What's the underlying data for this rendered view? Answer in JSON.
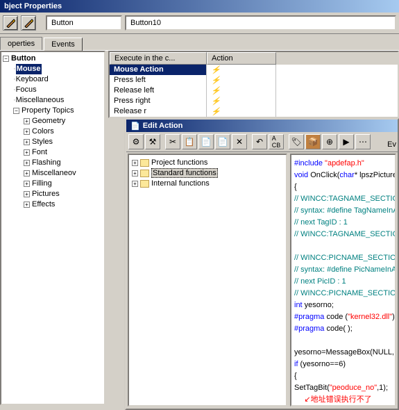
{
  "window": {
    "title": "bject Properties"
  },
  "toolbar": {
    "type_value": "Button",
    "name_value": "Button10"
  },
  "tabs": {
    "t0": "operties",
    "t1": "Events"
  },
  "tree": {
    "root": "Button",
    "n_mouse": "Mouse",
    "n_keyboard": "Keyboard",
    "n_focus": "Focus",
    "n_misc": "Miscellaneous",
    "n_property": "Property Topics",
    "p_geometry": "Geometry",
    "p_colors": "Colors",
    "p_styles": "Styles",
    "p_font": "Font",
    "p_flashing": "Flashing",
    "p_misc": "Miscellaneov",
    "p_filling": "Filling",
    "p_pictures": "Pictures",
    "p_effects": "Effects"
  },
  "grid": {
    "col_name": "Execute in the c...",
    "col_action": "Action",
    "r0": "Mouse Action",
    "r1": "Press left",
    "r2": "Release left",
    "r3": "Press right",
    "r4": "Release r"
  },
  "edit": {
    "title": "Edit Action",
    "btn_right": "Ev",
    "func": {
      "f0": "Project functions",
      "f1": "Standard functions",
      "f2": "Internal functions"
    },
    "code": {
      "l1_a": "#include ",
      "l1_b": "\"apdefap.h\"",
      "l2_a": "void",
      "l2_b": " OnClick(",
      "l2_c": "char",
      "l2_d": "* lpszPicture",
      "l3": "{",
      "l4": "// WINCC:TAGNAME_SECTIO",
      "l5": "// syntax: #define TagNameInA",
      "l6": "// next TagID : 1",
      "l7": "// WINCC:TAGNAME_SECTIO",
      "l8": "",
      "l9": "// WINCC:PICNAME_SECTIO",
      "l10": "// syntax: #define PicNameInA",
      "l11": "// next PicID : 1",
      "l12": "// WINCC:PICNAME_SECTIO",
      "l13_a": "int",
      "l13_b": " yesorno;",
      "l14_a": "#pragma",
      "l14_b": " code (",
      "l14_c": "\"kernel32.dll\"",
      "l14_d": ")",
      "l15_a": "#pragma",
      "l15_b": " code( );",
      "l16": "",
      "l17": "yesorno=MessageBox(NULL,",
      "l18_a": "if",
      "l18_b": " (yesorno==6)",
      "l19": "{",
      "l20_a": "SetTagBit(",
      "l20_b": "\"peoduce_no\"",
      "l20_c": ",1);",
      "annot": "地址错误执行不了"
    }
  }
}
